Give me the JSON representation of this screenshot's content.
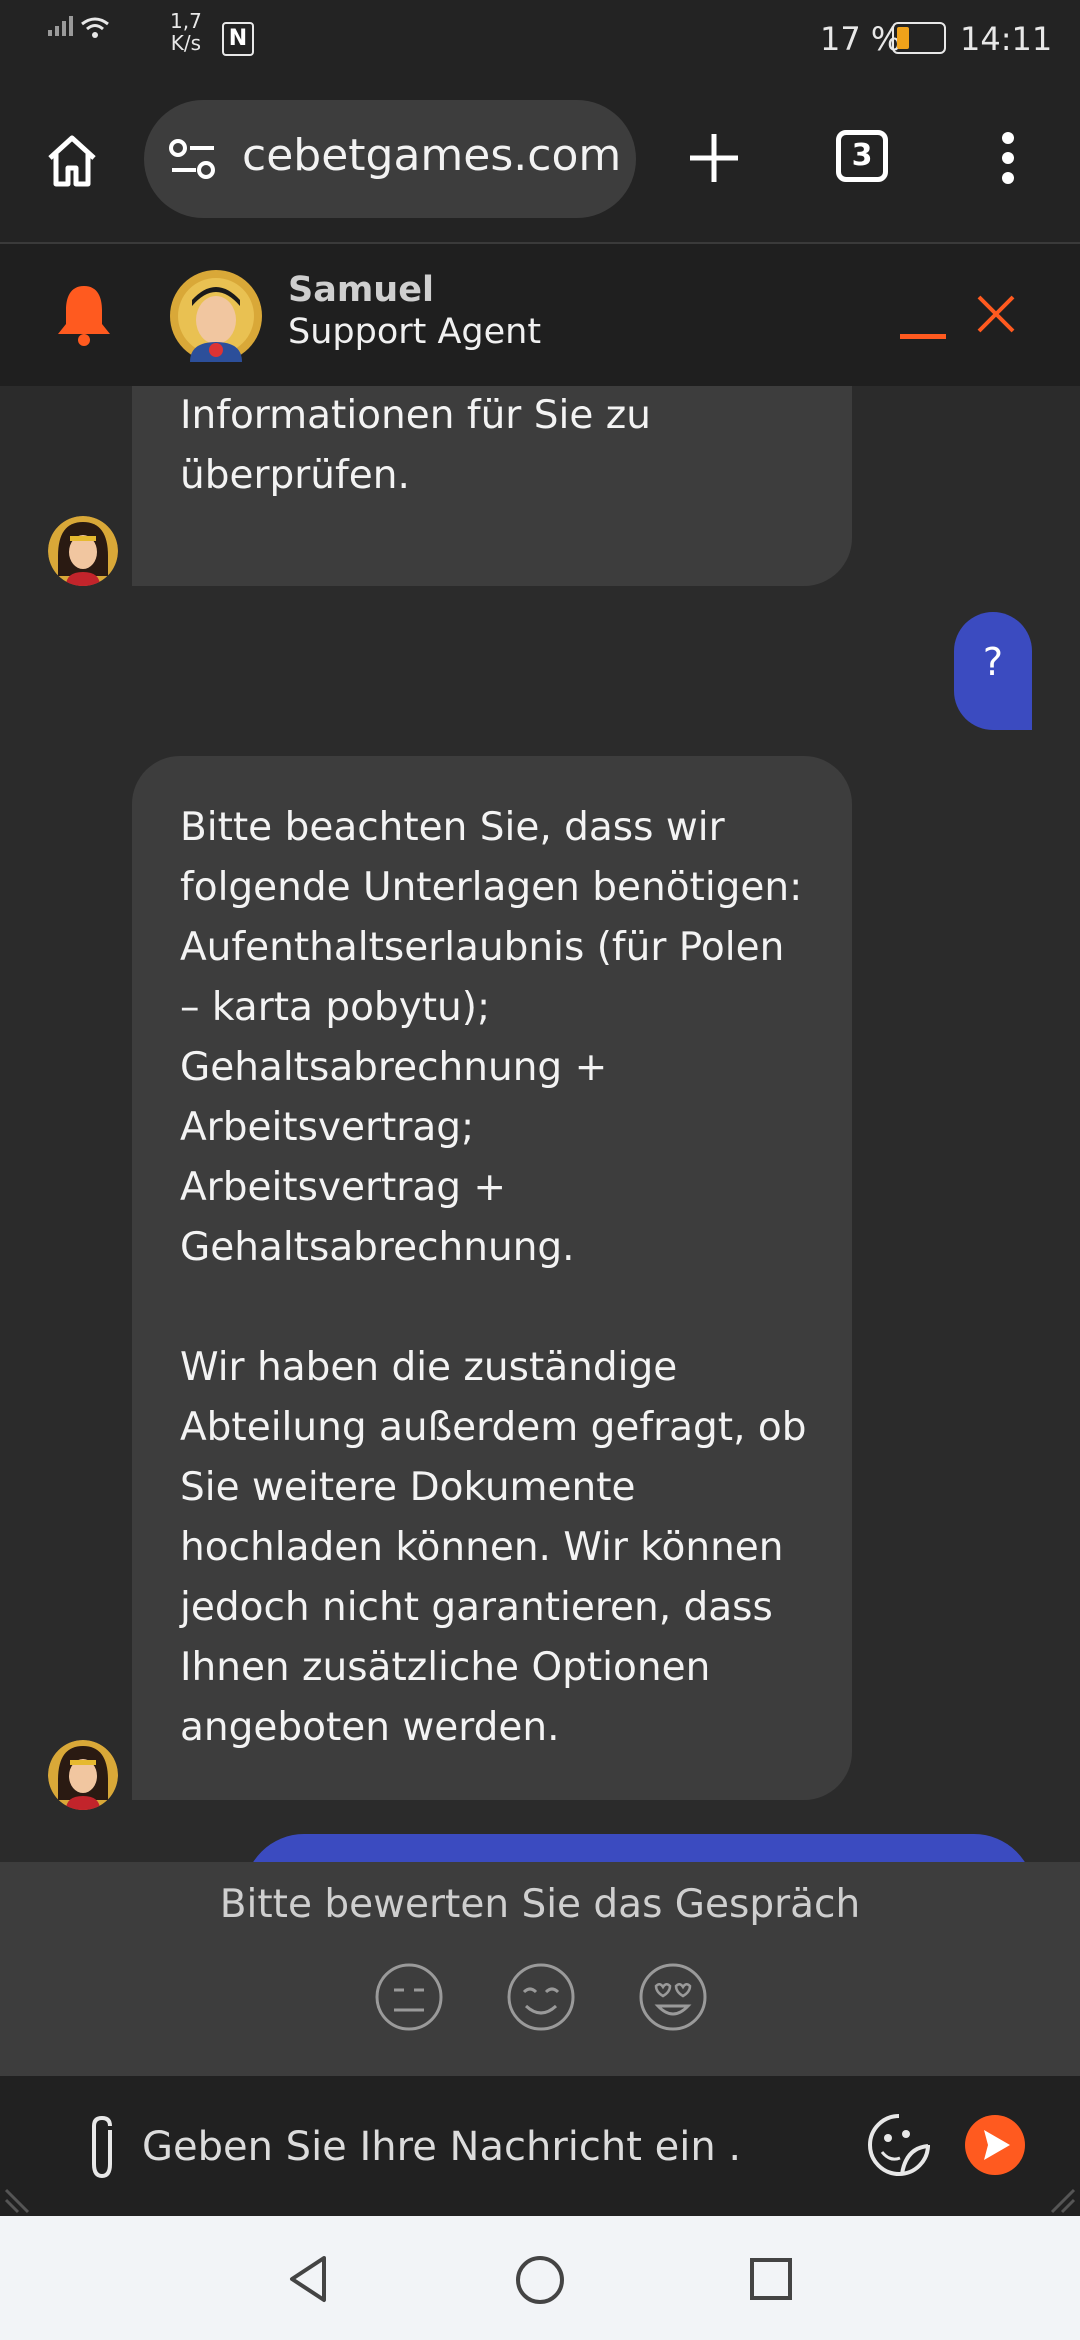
{
  "status_bar": {
    "speed_value": "1,7",
    "speed_unit": "K/s",
    "battery": "17 %",
    "time": "14:11"
  },
  "browser": {
    "url": "cebetgames.com",
    "tab_count": "3",
    "icons": [
      "home-icon",
      "site-settings-icon",
      "new-tab-icon",
      "tab-switcher-icon",
      "more-menu-icon"
    ]
  },
  "chat_header": {
    "agent_name": "Samuel",
    "agent_role": "Support Agent",
    "accent_color": "#ff5a1f"
  },
  "messages": [
    {
      "from": "agent",
      "text": "Minuten, um diese\nInformationen für Sie zu\nüberprüfen."
    },
    {
      "from": "user",
      "text": "?"
    },
    {
      "from": "agent",
      "text": "Bitte beachten Sie, dass wir\nfolgende Unterlagen benötigen:\nAufenthaltserlaubnis (für Polen\n– karta pobytu);\nGehaltsabrechnung +\nArbeitsvertrag;\nArbeitsvertrag +\nGehaltsabrechnung.\n\nWir haben die zuständige\nAbteilung außerdem gefragt, ob\nSie weitere Dokumente\nhochladen können. Wir können\njedoch nicht garantieren, dass\nIhnen zusätzliche Optionen\nangeboten werden."
    }
  ],
  "rating": {
    "title": "Bitte bewerten Sie das Gespräch",
    "options": [
      "neutral-face-icon",
      "smiling-face-icon",
      "heart-eyes-face-icon"
    ]
  },
  "composer": {
    "placeholder": "Geben Sie Ihre Nachricht ein ..."
  },
  "colors": {
    "user_bubble": "#3b4bc0",
    "agent_bubble": "#3d3d3d",
    "background": "#2b2b2b",
    "accent": "#ff5a1f"
  }
}
